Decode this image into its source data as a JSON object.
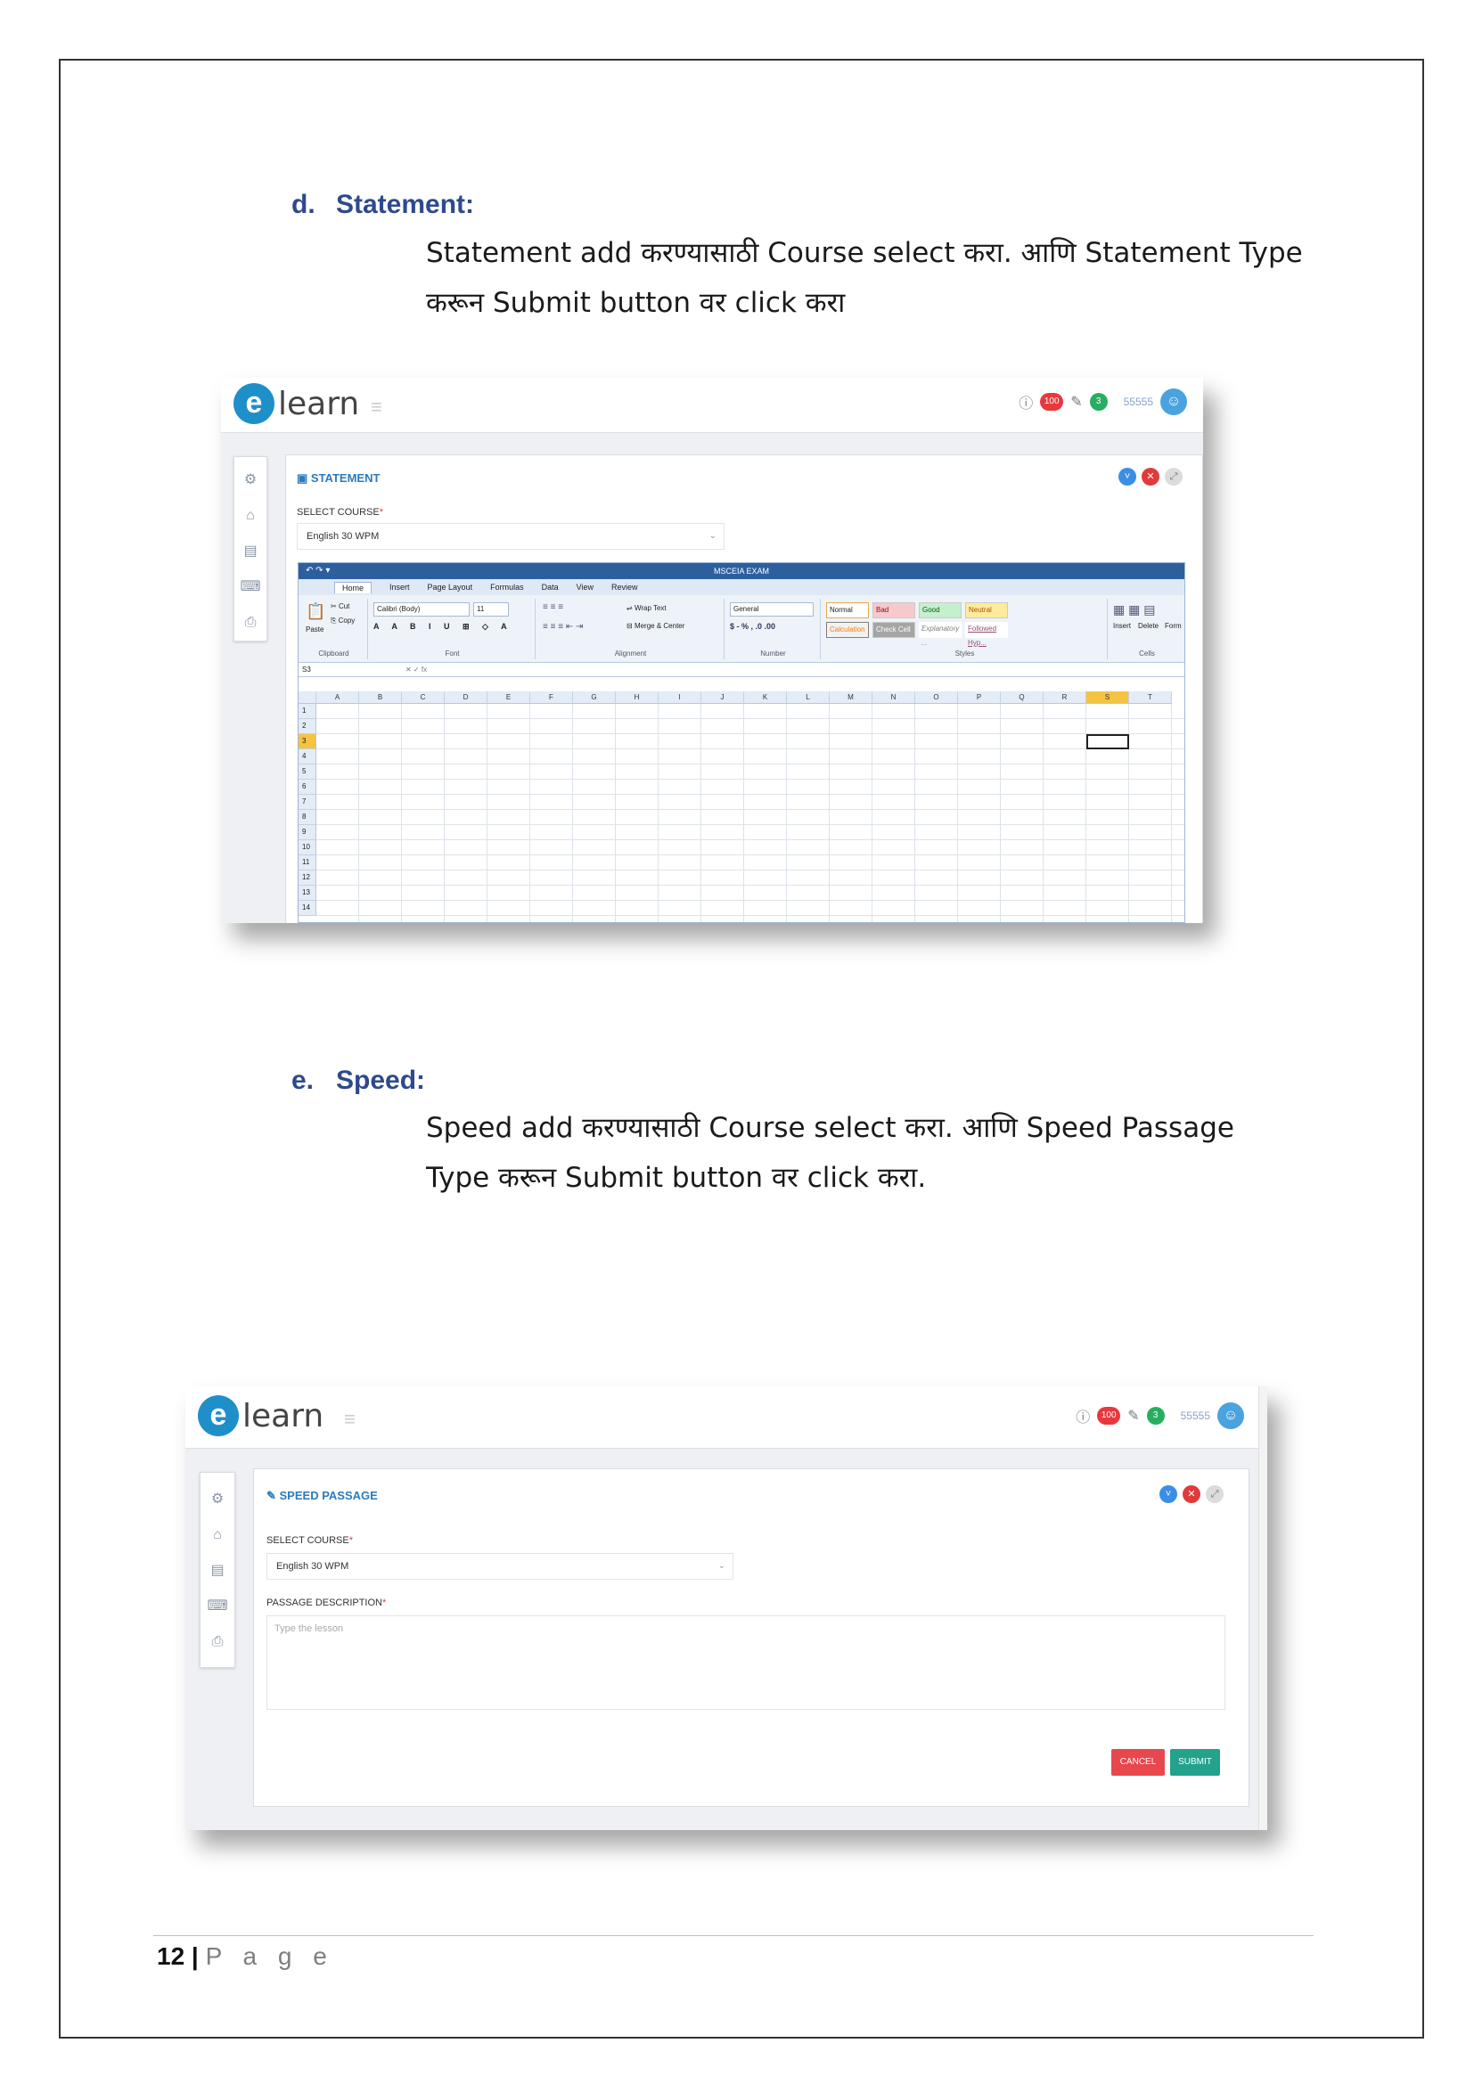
{
  "sections": [
    {
      "letter": "d.",
      "heading": "Statement:",
      "body_line1": "Statement add करण्यासाठी Course select करा. आणि Statement Type",
      "body_line2": "करून Submit button वर click करा"
    },
    {
      "letter": "e.",
      "heading": "Speed:",
      "body_line1": "Speed add करण्यासाठी Course select करा. आणि Speed Passage",
      "body_line2": "Type करून Submit button वर click करा."
    }
  ],
  "app": {
    "logo_letter": "e",
    "logo_text": "learn",
    "notif_count": "100",
    "edit_count": "3",
    "user_id": "55555"
  },
  "statement_shot": {
    "panel_title": "STATEMENT",
    "select_label": "SELECT COURSE",
    "select_value": "English 30 WPM",
    "excel": {
      "title": "MSCEIA EXAM",
      "tabs": [
        "Home",
        "Insert",
        "Page Layout",
        "Formulas",
        "Data",
        "View",
        "Review"
      ],
      "clipboard": {
        "paste": "Paste",
        "cut": "Cut",
        "copy": "Copy",
        "group": "Clipboard"
      },
      "font": {
        "name": "Calibri (Body)",
        "size": "11",
        "group": "Font"
      },
      "alignment": {
        "wrap": "Wrap Text",
        "merge": "Merge & Center",
        "group": "Alignment"
      },
      "number": {
        "format": "General",
        "group": "Number"
      },
      "styles": [
        "Normal",
        "Bad",
        "Good",
        "Neutral",
        "Calculation",
        "Check Cell",
        "Explanatory ...",
        "Followed Hyp..."
      ],
      "styles_group": "Styles",
      "cells": {
        "insert": "Insert",
        "delete": "Delete",
        "format": "Form",
        "group": "Cells"
      },
      "name_box": "S3",
      "columns": [
        "A",
        "B",
        "C",
        "D",
        "E",
        "F",
        "G",
        "H",
        "I",
        "J",
        "K",
        "L",
        "M",
        "N",
        "O",
        "P",
        "Q",
        "R",
        "S",
        "T"
      ],
      "rows": [
        "1",
        "2",
        "3",
        "4",
        "5",
        "6",
        "7",
        "8",
        "9",
        "10",
        "11",
        "12",
        "13",
        "14"
      ]
    }
  },
  "speed_shot": {
    "panel_title": "SPEED PASSAGE",
    "select_label": "SELECT COURSE",
    "select_value": "English 30 WPM",
    "desc_label": "PASSAGE DESCRIPTION",
    "desc_placeholder": "Type the lesson",
    "cancel": "CANCEL",
    "submit": "SUBMIT"
  },
  "footer": {
    "page_num": "12",
    "page_word": "P a g e"
  },
  "colors": {
    "heading": "#2e4a8c",
    "accent": "#2a7bbf",
    "cancel": "#e8474d",
    "submit": "#23a28c"
  }
}
